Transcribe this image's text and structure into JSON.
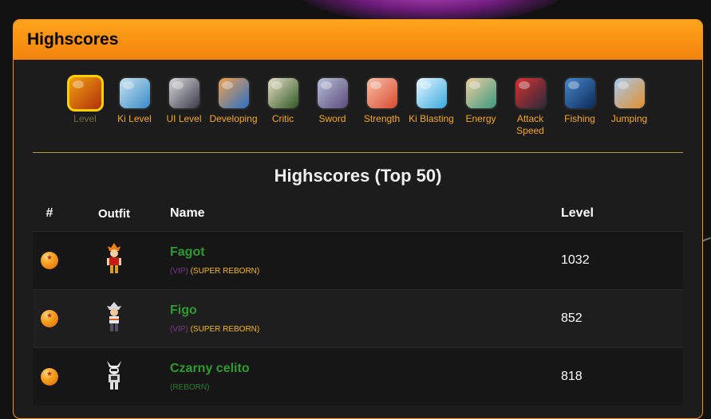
{
  "panel": {
    "title": "Highscores"
  },
  "skills": [
    {
      "label": "Level",
      "active": true,
      "colors": [
        "#f2a010",
        "#b03008"
      ]
    },
    {
      "label": "Ki Level",
      "active": false,
      "colors": [
        "#c8e4f0",
        "#3a88c8"
      ]
    },
    {
      "label": "UI Level",
      "active": false,
      "colors": [
        "#d8d8d8",
        "#3a3a4a"
      ]
    },
    {
      "label": "Developing",
      "active": false,
      "colors": [
        "#f0a050",
        "#2a70c8"
      ]
    },
    {
      "label": "Critic",
      "active": false,
      "colors": [
        "#e8e0c8",
        "#305820"
      ]
    },
    {
      "label": "Sword",
      "active": false,
      "colors": [
        "#b8c0d8",
        "#5a4a7a"
      ]
    },
    {
      "label": "Strength",
      "active": false,
      "colors": [
        "#f8c0a8",
        "#d84a30"
      ]
    },
    {
      "label": "Ki Blasting",
      "active": false,
      "colors": [
        "#e8f8ff",
        "#38a8e0"
      ]
    },
    {
      "label": "Energy",
      "active": false,
      "colors": [
        "#f0d0a0",
        "#3a9880"
      ]
    },
    {
      "label": "Attack Speed",
      "active": false,
      "colors": [
        "#d83030",
        "#2a2a3a"
      ]
    },
    {
      "label": "Fishing",
      "active": false,
      "colors": [
        "#4888c8",
        "#0a2a5a"
      ]
    },
    {
      "label": "Jumping",
      "active": false,
      "colors": [
        "#a8c8f0",
        "#e0902a"
      ]
    }
  ],
  "scores": {
    "title": "Highscores (Top 50)",
    "headers": {
      "rank": "#",
      "outfit": "Outfit",
      "name": "Name",
      "level": "Level"
    },
    "rows": [
      {
        "name": "Fagot",
        "vip": "(VIP)",
        "status": "(SUPER REBORN)",
        "level": "1032"
      },
      {
        "name": "Figo",
        "vip": "(VIP)",
        "status": "(SUPER REBORN)",
        "level": "852"
      },
      {
        "name": "Czarny celito",
        "vip": "",
        "status": "(REBORN)",
        "level": "818"
      }
    ]
  },
  "colors": {
    "accent": "#f7941d",
    "name": "#2f9b2f",
    "skill_label": "#f7a823"
  }
}
